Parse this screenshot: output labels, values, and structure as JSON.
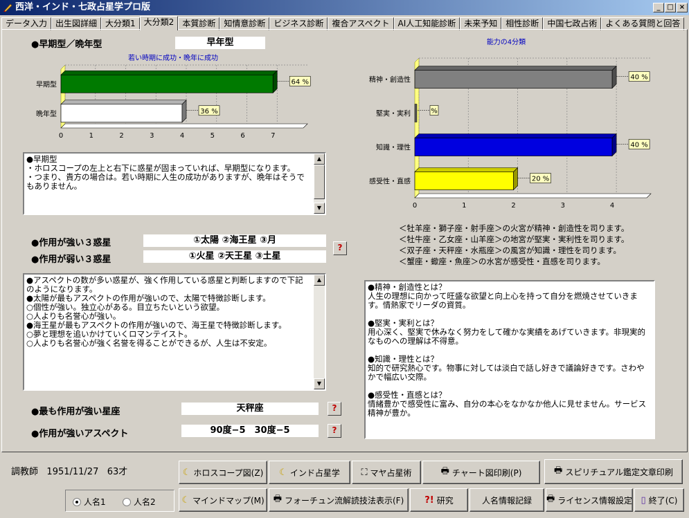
{
  "window": {
    "title": "西洋・インド・七政占星学プロ版",
    "minimize": "_",
    "maximize": "□",
    "close": "×"
  },
  "tabs": [
    "データ入力",
    "出生図詳細",
    "大分類1",
    "大分類2",
    "本質診断",
    "知情意診断",
    "ビジネス診断",
    "複合アスペクト",
    "AI人工知能診断",
    "未来予知",
    "相性診断",
    "中国七政占術",
    "よくある質問と回答"
  ],
  "active_tab": 3,
  "early_late": {
    "label": "●早期型／晩年型",
    "value": "早年型"
  },
  "chart_data": [
    {
      "type": "bar",
      "orientation": "horizontal",
      "title": "若い時期に成功・晩年に成功",
      "categories": [
        "早期型",
        "晩年型"
      ],
      "values": [
        7,
        4
      ],
      "value_labels": [
        "64 %",
        "36 %"
      ],
      "colors": [
        "#007a00",
        "#ffffff"
      ],
      "xlim": [
        0,
        8
      ],
      "xticks": [
        0,
        1,
        2,
        3,
        4,
        5,
        6,
        7
      ],
      "grid": true
    },
    {
      "type": "bar",
      "orientation": "horizontal",
      "title": "能力の4分類",
      "categories": [
        "精神・創造性",
        "堅実・実利",
        "知識・理性",
        "感受性・直感"
      ],
      "values": [
        4,
        0,
        4,
        2
      ],
      "value_labels": [
        "40 %",
        "%",
        "40 %",
        "20 %"
      ],
      "colors": [
        "#808080",
        "#808080",
        "#0000e0",
        "#ffff00"
      ],
      "xlim": [
        0,
        4.7
      ],
      "xticks": [
        0,
        1,
        2,
        3,
        4
      ],
      "grid": true
    }
  ],
  "early_text": "●早期型\n・ホロスコープの左上と右下に惑星が固まっていれば、早期型になります。\n・つまり、貴方の場合は。若い時期に人生の成功がありますが、晩年はそうでもありません。",
  "strong_planets": {
    "label": "●作用が強い３惑星",
    "value": "①太陽 ②海王星 ③月"
  },
  "weak_planets": {
    "label": "●作用が弱い３惑星",
    "value": "①火星 ②天王星 ③土星"
  },
  "help_mark": "?",
  "aspect_text": "●アスペクトの数が多い惑星が、強く作用している惑星と判断しますので下記のようになります。\n●太陽が最もアスペクトの作用が強いので、太陽で特徴診断します。\n○個性が強い。独立心がある。目立ちたいという欲望。\n○人よりも名誉心が強い。\n●海王星が最もアスペクトの作用が強いので、海王星で特徴診断します。\n○夢と理想を追いかけていくロマンテイスト。\n○人よりも名誉心が強く名誉を得ることができるが、人生は不安定。",
  "strongest_sign": {
    "label": "●最も作用が強い星座",
    "value": "天秤座"
  },
  "strong_aspect": {
    "label": "●作用が強いアスペクト",
    "value": "90度−5　30度−5"
  },
  "element_notes": [
    "＜牡羊座・獅子座・射手座＞の火宮が精神・創造性を司ります。",
    "＜牡牛座・乙女座・山羊座＞の地宮が堅実・実利性を司ります。",
    "＜双子座・天秤座・水瓶座＞の風宮が知識・理性を司ります。",
    "＜蟹座・蠍座・魚座＞の水宮が感受性・直感を司ります。"
  ],
  "ability_text": "●精神・創造性とは？\n人生の理想に向かって旺盛な欲望と向上心を持って自分を燃焼させていきます。情熱家でリーダの資質。\n\n●堅実・実利とは？\n用心深く、堅実で休みなく努力をして確かな実績をあげていきます。非現実的なものへの理解は不得意。\n\n●知識・理性とは？\n知的で研究熱心です。物事に対しては淡白で話し好きで議論好きです。さわやかで幅広い交際。\n\n●感受性・直感とは？\n情緒豊かで感受性に富み、自分の本心をなかなか他人に見せません。サービス精神が豊か。",
  "person": {
    "name": "調教師",
    "birthdate": "1951/11/27",
    "age": "63才"
  },
  "radio": {
    "name1": "人名1",
    "name2": "人名2",
    "selected": 1
  },
  "buttons": {
    "horoscope": "ホロスコープ図(Z)",
    "indian": "インド占星学",
    "maya": "マヤ占星術",
    "chart_print": "チャート図印刷(P)",
    "spiritual_print": "スピリチュアル鑑定文章印刷",
    "mindmap": "マインドマップ(M)",
    "fortune": "フォーチュン流解読技法表示(F)",
    "research": "研究",
    "person_record": "人名情報記録",
    "license": "ライセンス情報設定",
    "exit": "終了(C)"
  }
}
